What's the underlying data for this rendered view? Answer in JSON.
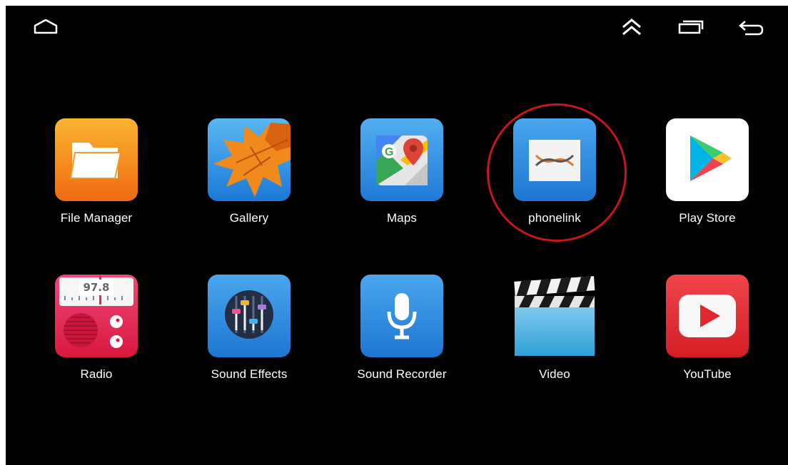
{
  "navbar": {
    "home_icon": "home-outline-icon",
    "up_icon": "double-chevron-up-icon",
    "recents_icon": "recent-apps-icon",
    "back_icon": "back-arrow-icon"
  },
  "apps": [
    {
      "id": "file-manager",
      "label": "File Manager",
      "icon": "folder-icon"
    },
    {
      "id": "gallery",
      "label": "Gallery",
      "icon": "maple-leaf-icon"
    },
    {
      "id": "maps",
      "label": "Maps",
      "icon": "google-maps-icon"
    },
    {
      "id": "phonelink",
      "label": "phonelink",
      "icon": "phonelink-icon"
    },
    {
      "id": "play-store",
      "label": "Play Store",
      "icon": "play-store-icon"
    },
    {
      "id": "radio",
      "label": "Radio",
      "icon": "radio-icon",
      "display": "97.8"
    },
    {
      "id": "sound-effects",
      "label": "Sound Effects",
      "icon": "equalizer-icon"
    },
    {
      "id": "sound-recorder",
      "label": "Sound Recorder",
      "icon": "microphone-icon"
    },
    {
      "id": "video",
      "label": "Video",
      "icon": "clapperboard-icon"
    },
    {
      "id": "youtube",
      "label": "YouTube",
      "icon": "youtube-icon"
    }
  ],
  "highlight": {
    "target": "phonelink",
    "color": "#c8141c"
  }
}
